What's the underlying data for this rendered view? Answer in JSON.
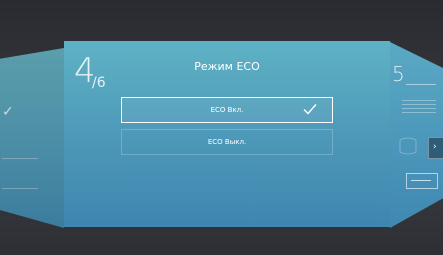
{
  "wizard": {
    "step_current": "4",
    "step_total": "/6",
    "title": "Режим ECO",
    "options": [
      {
        "label": "ECO Вкл.",
        "selected": true
      },
      {
        "label": "ECO Выкл.",
        "selected": false
      }
    ],
    "next_step_number": "5"
  },
  "colors": {
    "panel_top": "#5fb2c5",
    "panel_bottom": "#3f86b0",
    "background": "#2f3035"
  },
  "icons": {
    "selected_option": "check-icon",
    "side_left": "check-icon",
    "side_right_box": "chevron-right-icon"
  }
}
